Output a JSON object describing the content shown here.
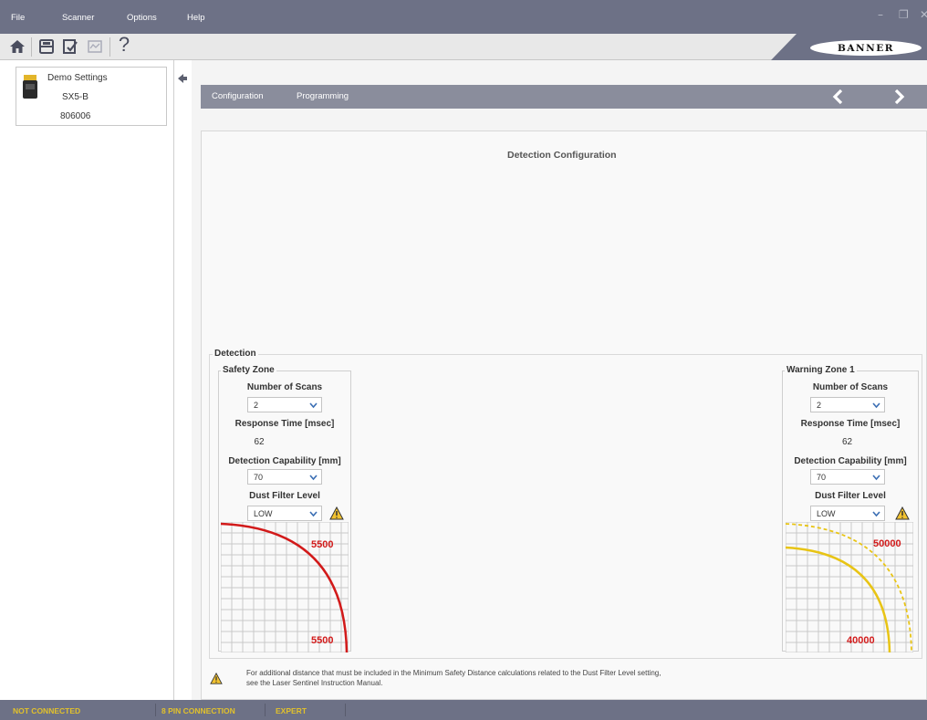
{
  "menu": {
    "items": [
      "File",
      "Scanner",
      "Options",
      "Help"
    ]
  },
  "window_controls": {
    "minimize": "–",
    "restore": "❐",
    "close": "✕"
  },
  "toolbar": {
    "icons": [
      "home-icon",
      "save-icon",
      "verify-icon",
      "monitor-icon",
      "help-icon"
    ],
    "help_glyph": "?",
    "brand": "BANNER"
  },
  "device": {
    "name": "Demo Settings",
    "model": "SX5-B",
    "serial": "806006"
  },
  "nav": {
    "tabs": [
      "Configuration",
      "Programming"
    ]
  },
  "main": {
    "title": "Detection Configuration",
    "group_label": "Detection",
    "zones": [
      {
        "title": "Safety Zone",
        "scans_label": "Number of Scans",
        "scans_value": "2",
        "response_label": "Response Time [msec]",
        "response_value": "62",
        "capability_label": "Detection Capability [mm]",
        "capability_value": "70",
        "dust_label": "Dust Filter Level",
        "dust_value": "LOW",
        "range_top": "5500",
        "range_bottom": "5500",
        "curve_color": "#d21a1a"
      },
      {
        "title": "Warning Zone 1",
        "scans_label": "Number of Scans",
        "scans_value": "2",
        "response_label": "Response Time [msec]",
        "response_value": "62",
        "capability_label": "Detection Capability [mm]",
        "capability_value": "70",
        "dust_label": "Dust Filter Level",
        "dust_value": "LOW",
        "range_top": "50000",
        "range_bottom": "40000",
        "curve_color": "#e8c415"
      }
    ],
    "footnote_line1": "For additional distance that must be included in the Minimum Safety Distance calculations related to the Dust Filter Level setting,",
    "footnote_line2": "see the Laser Sentinel Instruction Manual."
  },
  "status": {
    "items": [
      "NOT CONNECTED",
      "8 PIN CONNECTION",
      "EXPERT"
    ],
    "color": "#e2c12b"
  },
  "colors": {
    "chrome": "#6d7186",
    "nav_bar": "#8a8d9c",
    "warning": "#f2c230"
  }
}
